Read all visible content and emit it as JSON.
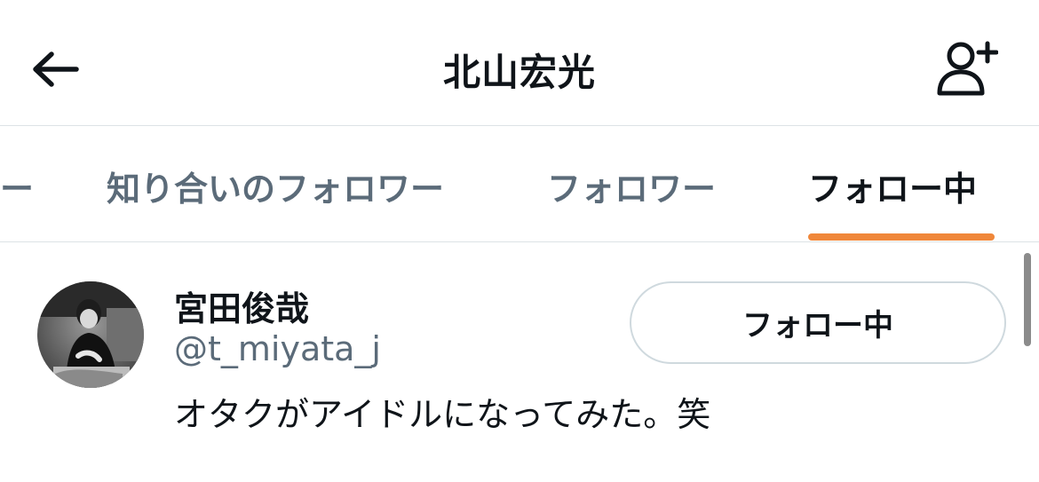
{
  "header": {
    "title": "北山宏光",
    "back_icon": "arrow-left-icon",
    "add_icon": "person-add-icon"
  },
  "tabs": [
    {
      "label": "ー",
      "active": false
    },
    {
      "label": "知り合いのフォロワー",
      "active": false
    },
    {
      "label": "フォロワー",
      "active": false
    },
    {
      "label": "フォロー中",
      "active": true
    }
  ],
  "colors": {
    "accent": "#f0873a",
    "text_primary": "#0f1419",
    "text_secondary": "#5b6b79",
    "divider": "#dde3e6",
    "button_border": "#cfd9de"
  },
  "users": [
    {
      "name": "宮田俊哉",
      "handle": "@t_miyata_j",
      "bio": "オタクがアイドルになってみた。笑",
      "button_label": "フォロー中"
    }
  ]
}
